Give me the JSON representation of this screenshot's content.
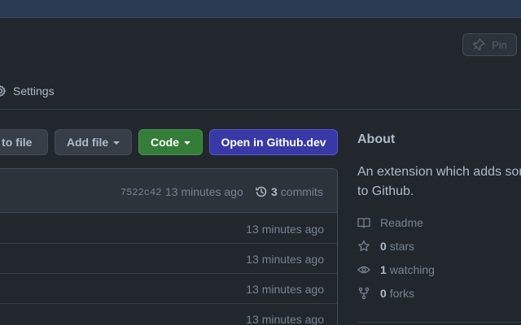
{
  "header": {
    "pin_label": "Pin",
    "settings_label": "Settings"
  },
  "toolbar": {
    "goto_file_label": "o to file",
    "add_file_label": "Add file",
    "code_label": "Code",
    "open_dev_label": "Open in Github.dev"
  },
  "commit": {
    "hash": "7522c42",
    "time": "13 minutes ago",
    "count": "3",
    "count_label": "commits"
  },
  "files": [
    {
      "time": "13 minutes ago"
    },
    {
      "time": "13 minutes ago"
    },
    {
      "time": "13 minutes ago"
    },
    {
      "time": "13 minutes ago"
    }
  ],
  "about": {
    "title": "About",
    "description_line1": "An extension which adds som",
    "description_line2": "to Github.",
    "readme_label": "Readme",
    "stars_count": "0",
    "stars_label": "stars",
    "watching_count": "1",
    "watching_label": "watching",
    "forks_count": "0",
    "forks_label": "forks"
  },
  "colors": {
    "background": "#22272e",
    "code_button": "#347d39",
    "dev_button": "#3838a6",
    "text": "#adbac7",
    "muted": "#768390"
  },
  "icons": [
    "pin-icon",
    "gear-icon",
    "history-icon",
    "book-icon",
    "star-icon",
    "eye-icon",
    "fork-icon"
  ]
}
